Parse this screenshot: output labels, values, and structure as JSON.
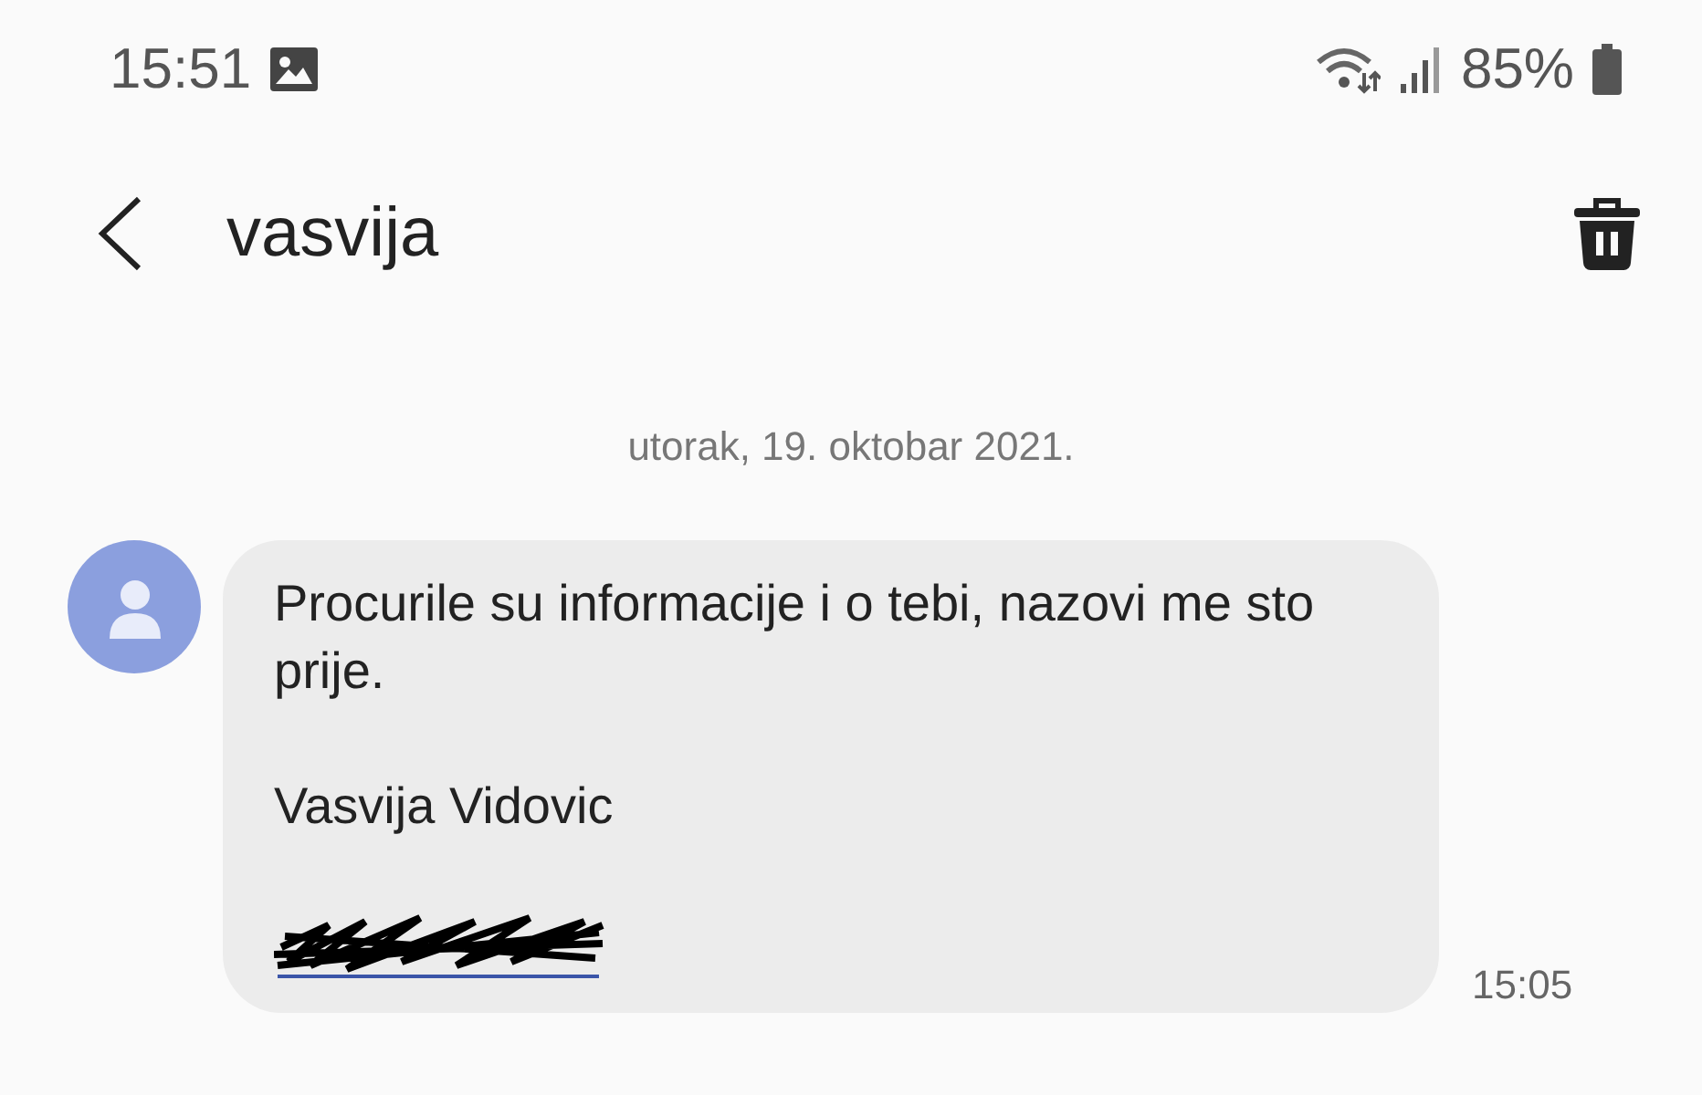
{
  "status_bar": {
    "time": "15:51",
    "battery": "85%"
  },
  "header": {
    "title": "vasvija"
  },
  "date_divider": "utorak, 19. oktobar 2021.",
  "messages": [
    {
      "paragraphs": [
        "Procurile su informacije i o tebi, nazovi me sto prije.",
        "Vasvija Vidovic"
      ],
      "redacted_link": true,
      "time": "15:05"
    }
  ]
}
